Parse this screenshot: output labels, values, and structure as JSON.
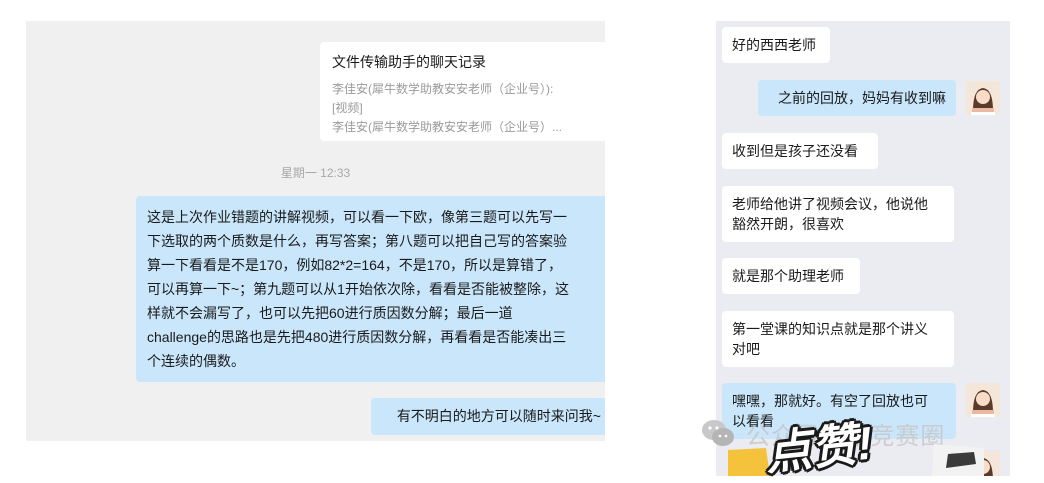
{
  "left_chat": {
    "card": {
      "title": "文件传输助手的聊天记录",
      "line1": "李佳安(犀牛数学助教安安老师（企业号）):",
      "line2": "[视频]",
      "line3": "李佳安(犀牛数学助教安安老师（企业号）..."
    },
    "timestamp": "星期一 12:33",
    "messages": [
      {
        "lines": [
          "这是上次作业错题的讲解视频，可以看一下欧，像第三题可以先写一",
          "下选取的两个质数是什么，再写答案；第八题可以把自己写的答案验",
          "算一下看看是不是170，例如82*2=164，不是170，所以是算错了，",
          "可以再算一下~；第九题可以从1开始依次除，看看是否能被整除，这",
          "样就不会漏写了，也可以先把60进行质因数分解；最后一道",
          "challenge的思路也是先把480进行质因数分解，再看看是否能凑出三",
          "个连续的偶数。"
        ]
      },
      {
        "text": "有不明白的地方可以随时来问我~"
      }
    ]
  },
  "right_chat": {
    "messages": [
      {
        "side": "left",
        "lines": [
          "好的西西老师"
        ]
      },
      {
        "side": "right",
        "lines": [
          "之前的回放，妈妈有收到嘛"
        ]
      },
      {
        "side": "left",
        "lines": [
          "收到但是孩子还没看"
        ]
      },
      {
        "side": "left",
        "lines": [
          "老师给他讲了视频会议，他说他",
          "豁然开朗，很喜欢"
        ]
      },
      {
        "side": "left",
        "lines": [
          "就是那个助理老师"
        ]
      },
      {
        "side": "left",
        "lines": [
          "第一堂课的知识点就是那个讲义",
          "对吧"
        ]
      },
      {
        "side": "right",
        "lines": [
          "嘿嘿，那就好。有空了回放也可",
          "以看看"
        ]
      }
    ]
  },
  "watermark": {
    "account": "公众号 · 小竞赛圈",
    "sticker": "点赞!"
  },
  "colors": {
    "bubble_blue": "#c9e6fb",
    "panel_grey": "#f0f0f0",
    "right_panel_bg": "#eaecf1"
  }
}
